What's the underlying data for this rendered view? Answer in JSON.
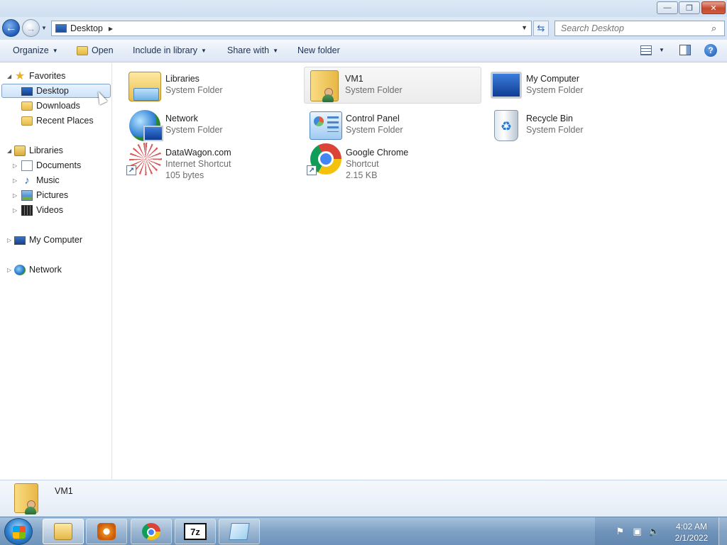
{
  "window": {
    "minimize_label": "—",
    "maximize_label": "❐",
    "close_label": "✕"
  },
  "address": {
    "location": "Desktop",
    "search_placeholder": "Search Desktop"
  },
  "toolbar": {
    "organize": "Organize",
    "open": "Open",
    "include_in_library": "Include in library",
    "share_with": "Share with",
    "new_folder": "New folder",
    "help": "?"
  },
  "nav": {
    "favorites": "Favorites",
    "desktop": "Desktop",
    "downloads": "Downloads",
    "recent_places": "Recent Places",
    "libraries": "Libraries",
    "documents": "Documents",
    "music": "Music",
    "pictures": "Pictures",
    "videos": "Videos",
    "my_computer": "My Computer",
    "network": "Network"
  },
  "items": [
    {
      "name": "Libraries",
      "sub1": "System Folder",
      "sub2": ""
    },
    {
      "name": "VM1",
      "sub1": "System Folder",
      "sub2": ""
    },
    {
      "name": "My Computer",
      "sub1": "System Folder",
      "sub2": ""
    },
    {
      "name": "Network",
      "sub1": "System Folder",
      "sub2": ""
    },
    {
      "name": "Control Panel",
      "sub1": "System Folder",
      "sub2": ""
    },
    {
      "name": "Recycle Bin",
      "sub1": "System Folder",
      "sub2": ""
    },
    {
      "name": "DataWagon.com",
      "sub1": "Internet Shortcut",
      "sub2": "105 bytes"
    },
    {
      "name": "Google Chrome",
      "sub1": "Shortcut",
      "sub2": "2.15 KB"
    }
  ],
  "details": {
    "name": "VM1"
  },
  "taskbar": {
    "seven_zip_label": "7z",
    "time": "4:02 AM",
    "date": "2/1/2022"
  }
}
